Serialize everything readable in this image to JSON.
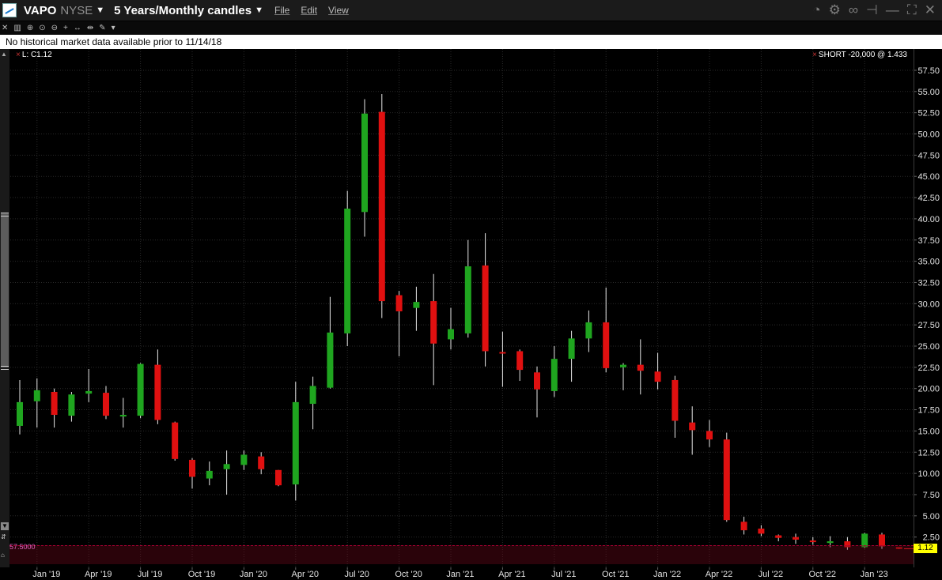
{
  "header": {
    "ticker": "VAPO",
    "exchange": "NYSE",
    "period": "5 Years/Monthly candles",
    "menu": [
      "File",
      "Edit",
      "View"
    ]
  },
  "notice": "No historical market data available prior to 11/14/18",
  "labels": {
    "last_close": "L: C1.12",
    "position": "SHORT -20,000 @ 1.433",
    "order_price": "57.5000",
    "current_price": "1.12"
  },
  "colors": {
    "up": "#1fa51f",
    "down": "#e01010",
    "price_tag": "#ffff00",
    "background": "#000000",
    "grid": "#2a2a2a"
  },
  "chart_data": {
    "type": "candlestick",
    "title": "",
    "xlabel": "",
    "ylabel": "",
    "ylim": [
      0,
      58.5
    ],
    "y_ticks": [
      "2.50",
      "5.00",
      "7.50",
      "10.00",
      "12.50",
      "15.00",
      "17.50",
      "20.00",
      "22.50",
      "25.00",
      "27.50",
      "30.00",
      "32.50",
      "35.00",
      "37.50",
      "40.00",
      "42.50",
      "45.00",
      "47.50",
      "50.00",
      "52.50",
      "55.00",
      "57.50"
    ],
    "x_labels": [
      {
        "label": "Jan '19",
        "index": 1
      },
      {
        "label": "Apr '19",
        "index": 4
      },
      {
        "label": "Jul '19",
        "index": 7
      },
      {
        "label": "Oct '19",
        "index": 10
      },
      {
        "label": "Jan '20",
        "index": 13
      },
      {
        "label": "Apr '20",
        "index": 16
      },
      {
        "label": "Jul '20",
        "index": 19
      },
      {
        "label": "Oct '20",
        "index": 22
      },
      {
        "label": "Jan '21",
        "index": 25
      },
      {
        "label": "Apr '21",
        "index": 28
      },
      {
        "label": "Jul '21",
        "index": 31
      },
      {
        "label": "Oct '21",
        "index": 34
      },
      {
        "label": "Jan '22",
        "index": 37
      },
      {
        "label": "Apr '22",
        "index": 40
      },
      {
        "label": "Jul '22",
        "index": 43
      },
      {
        "label": "Oct '22",
        "index": 46
      },
      {
        "label": "Jan '23",
        "index": 49
      }
    ],
    "grid": true,
    "candles": [
      {
        "month": "Nov 2018",
        "open": 15.6,
        "high": 21.0,
        "low": 14.6,
        "close": 18.4
      },
      {
        "month": "Dec 2018",
        "open": 18.5,
        "high": 21.2,
        "low": 15.4,
        "close": 19.8
      },
      {
        "month": "Jan 2019",
        "open": 19.6,
        "high": 20.0,
        "low": 15.4,
        "close": 16.9
      },
      {
        "month": "Feb 2019",
        "open": 16.8,
        "high": 19.6,
        "low": 16.1,
        "close": 19.3
      },
      {
        "month": "Mar 2019",
        "open": 19.4,
        "high": 22.3,
        "low": 18.4,
        "close": 19.7
      },
      {
        "month": "Apr 2019",
        "open": 19.5,
        "high": 20.3,
        "low": 16.4,
        "close": 16.8
      },
      {
        "month": "May 2019",
        "open": 16.7,
        "high": 18.9,
        "low": 15.4,
        "close": 16.9
      },
      {
        "month": "Jun 2019",
        "open": 16.8,
        "high": 23.0,
        "low": 16.5,
        "close": 22.9
      },
      {
        "month": "Jul 2019",
        "open": 22.8,
        "high": 24.6,
        "low": 15.8,
        "close": 16.3
      },
      {
        "month": "Aug 2019",
        "open": 16.0,
        "high": 16.1,
        "low": 11.5,
        "close": 11.7
      },
      {
        "month": "Sep 2019",
        "open": 11.6,
        "high": 11.8,
        "low": 8.2,
        "close": 9.6
      },
      {
        "month": "Oct 2019",
        "open": 9.4,
        "high": 11.4,
        "low": 8.6,
        "close": 10.3
      },
      {
        "month": "Nov 2019",
        "open": 10.5,
        "high": 12.7,
        "low": 7.5,
        "close": 11.1
      },
      {
        "month": "Dec 2019",
        "open": 11.0,
        "high": 12.7,
        "low": 10.4,
        "close": 12.2
      },
      {
        "month": "Jan 2020",
        "open": 12.0,
        "high": 12.5,
        "low": 9.9,
        "close": 10.5
      },
      {
        "month": "Feb 2020",
        "open": 10.4,
        "high": 10.4,
        "low": 8.5,
        "close": 8.6
      },
      {
        "month": "Mar 2020",
        "open": 8.7,
        "high": 20.8,
        "low": 6.8,
        "close": 18.4
      },
      {
        "month": "Apr 2020",
        "open": 18.2,
        "high": 21.4,
        "low": 15.2,
        "close": 20.3
      },
      {
        "month": "May 2020",
        "open": 20.1,
        "high": 30.8,
        "low": 20.0,
        "close": 26.6
      },
      {
        "month": "Jun 2020",
        "open": 26.5,
        "high": 43.3,
        "low": 25.0,
        "close": 41.2
      },
      {
        "month": "Jul 2020",
        "open": 40.8,
        "high": 54.1,
        "low": 37.9,
        "close": 52.4
      },
      {
        "month": "Aug 2020",
        "open": 52.6,
        "high": 54.7,
        "low": 28.3,
        "close": 30.3
      },
      {
        "month": "Sep 2020",
        "open": 31.0,
        "high": 31.5,
        "low": 23.8,
        "close": 29.1
      },
      {
        "month": "Oct 2020",
        "open": 29.5,
        "high": 32.0,
        "low": 26.8,
        "close": 30.2
      },
      {
        "month": "Nov 2020",
        "open": 30.3,
        "high": 33.5,
        "low": 20.4,
        "close": 25.3
      },
      {
        "month": "Dec 2020",
        "open": 25.8,
        "high": 29.5,
        "low": 24.6,
        "close": 27.0
      },
      {
        "month": "Jan 2021",
        "open": 26.5,
        "high": 37.5,
        "low": 26.0,
        "close": 34.4
      },
      {
        "month": "Feb 2021",
        "open": 34.5,
        "high": 38.3,
        "low": 22.6,
        "close": 24.4
      },
      {
        "month": "Mar 2021",
        "open": 24.3,
        "high": 26.7,
        "low": 20.2,
        "close": 24.2
      },
      {
        "month": "Apr 2021",
        "open": 24.4,
        "high": 24.6,
        "low": 20.9,
        "close": 22.2
      },
      {
        "month": "May 2021",
        "open": 21.9,
        "high": 22.6,
        "low": 16.6,
        "close": 19.9
      },
      {
        "month": "Jun 2021",
        "open": 19.7,
        "high": 25.0,
        "low": 19.0,
        "close": 23.5
      },
      {
        "month": "Jul 2021",
        "open": 23.5,
        "high": 26.8,
        "low": 20.8,
        "close": 25.9
      },
      {
        "month": "Aug 2021",
        "open": 25.9,
        "high": 29.2,
        "low": 24.3,
        "close": 27.8
      },
      {
        "month": "Sep 2021",
        "open": 27.8,
        "high": 31.9,
        "low": 21.9,
        "close": 22.4
      },
      {
        "month": "Oct 2021",
        "open": 22.5,
        "high": 23.0,
        "low": 19.8,
        "close": 22.8
      },
      {
        "month": "Nov 2021",
        "open": 22.8,
        "high": 25.8,
        "low": 19.3,
        "close": 22.1
      },
      {
        "month": "Dec 2021",
        "open": 22.0,
        "high": 24.2,
        "low": 19.9,
        "close": 20.8
      },
      {
        "month": "Jan 2022",
        "open": 21.0,
        "high": 21.5,
        "low": 14.2,
        "close": 16.2
      },
      {
        "month": "Feb 2022",
        "open": 16.0,
        "high": 17.9,
        "low": 12.2,
        "close": 15.1
      },
      {
        "month": "Mar 2022",
        "open": 15.0,
        "high": 16.3,
        "low": 13.1,
        "close": 14.0
      },
      {
        "month": "Apr 2022",
        "open": 14.0,
        "high": 14.8,
        "low": 4.3,
        "close": 4.5
      },
      {
        "month": "May 2022",
        "open": 4.3,
        "high": 4.9,
        "low": 2.8,
        "close": 3.3
      },
      {
        "month": "Jun 2022",
        "open": 3.5,
        "high": 3.9,
        "low": 2.6,
        "close": 2.9
      },
      {
        "month": "Jul 2022",
        "open": 2.7,
        "high": 2.8,
        "low": 2.0,
        "close": 2.4
      },
      {
        "month": "Aug 2022",
        "open": 2.5,
        "high": 2.9,
        "low": 1.7,
        "close": 2.2
      },
      {
        "month": "Sep 2022",
        "open": 2.1,
        "high": 2.5,
        "low": 1.6,
        "close": 1.9
      },
      {
        "month": "Oct 2022",
        "open": 1.8,
        "high": 2.6,
        "low": 1.3,
        "close": 2.0
      },
      {
        "month": "Nov 2022",
        "open": 2.0,
        "high": 2.5,
        "low": 1.0,
        "close": 1.3
      },
      {
        "month": "Dec 2022",
        "open": 1.3,
        "high": 3.0,
        "low": 1.2,
        "close": 2.9
      },
      {
        "month": "Jan 2023",
        "open": 2.8,
        "high": 3.0,
        "low": 1.1,
        "close": 1.4
      },
      {
        "month": "Feb 2023",
        "open": 1.3,
        "high": 1.3,
        "low": 1.1,
        "close": 1.12
      }
    ]
  }
}
